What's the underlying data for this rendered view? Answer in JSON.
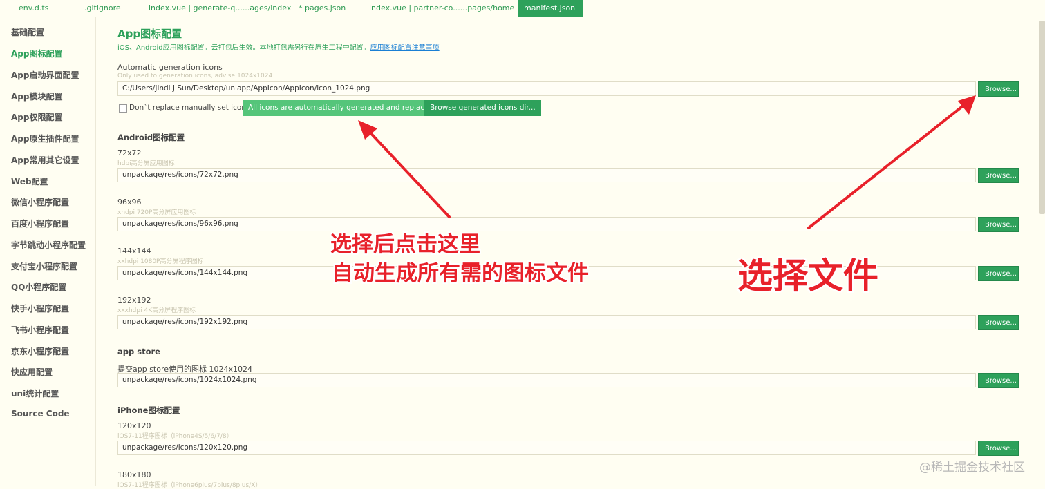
{
  "tabs": [
    {
      "label": "env.d.ts"
    },
    {
      "label": ".gitignore"
    },
    {
      "label": "index.vue | generate-q......ages/index"
    },
    {
      "label": "* pages.json"
    },
    {
      "label": "index.vue | partner-co......pages/home"
    },
    {
      "label": "manifest.json"
    }
  ],
  "sidebar": {
    "items": [
      {
        "label": "基础配置"
      },
      {
        "label": "App图标配置"
      },
      {
        "label": "App启动界面配置"
      },
      {
        "label": "App模块配置"
      },
      {
        "label": "App权限配置"
      },
      {
        "label": "App原生插件配置"
      },
      {
        "label": "App常用其它设置"
      },
      {
        "label": "Web配置"
      },
      {
        "label": "微信小程序配置"
      },
      {
        "label": "百度小程序配置"
      },
      {
        "label": "字节跳动小程序配置"
      },
      {
        "label": "支付宝小程序配置"
      },
      {
        "label": "QQ小程序配置"
      },
      {
        "label": "快手小程序配置"
      },
      {
        "label": "飞书小程序配置"
      },
      {
        "label": "京东小程序配置"
      },
      {
        "label": "快应用配置"
      },
      {
        "label": "uni统计配置"
      },
      {
        "label": "Source Code"
      }
    ]
  },
  "main": {
    "title": "App图标配置",
    "description": "iOS、Android应用图标配置。云打包后生效。本地打包需另行在原生工程中配置。",
    "description_link": "应用图标配置注意事项",
    "auto": {
      "label": "Automatic generation icons",
      "hint": "Only used to generation icons, advise:1024x1024",
      "value": "C:/Users/Jindi J Sun/Desktop/uniapp/AppIcon/AppIcon/icon_1024.png",
      "browse_label": "Browse...",
      "checkbox_label": "Don`t replace manually set icons",
      "generate_label": "All icons are automatically generated and replaced",
      "browse_dir_label": "Browse generated icons dir..."
    },
    "android_title": "Android图标配置",
    "android": [
      {
        "label": "72x72",
        "hint": "hdpi高分屏应用图标",
        "value": "unpackage/res/icons/72x72.png",
        "browse": "Browse..."
      },
      {
        "label": "96x96",
        "hint": "xhdpi 720P高分屏应用图标",
        "value": "unpackage/res/icons/96x96.png",
        "browse": "Browse..."
      },
      {
        "label": "144x144",
        "hint": "xxhdpi 1080P高分屏程序图标",
        "value": "unpackage/res/icons/144x144.png",
        "browse": "Browse..."
      },
      {
        "label": "192x192",
        "hint": "xxxhdpi 4K高分屏程序图标",
        "value": "unpackage/res/icons/192x192.png",
        "browse": "Browse..."
      }
    ],
    "appstore_title": "app store",
    "appstore": {
      "label": "提交app store使用的图标 1024x1024",
      "value": "unpackage/res/icons/1024x1024.png",
      "browse": "Browse..."
    },
    "iphone_title": "iPhone图标配置",
    "iphone": [
      {
        "label": "120x120",
        "hint": "iOS7-11程序图标（iPhone4S/5/6/7/8）",
        "value": "unpackage/res/icons/120x120.png",
        "browse": "Browse..."
      },
      {
        "label": "180x180",
        "hint": "iOS7-11程序图标（iPhone6plus/7plus/8plus/X）"
      }
    ]
  },
  "annotations": {
    "left_line1": "选择后点击这里",
    "left_line2": "自动生成所有需的图标文件",
    "right": "选择文件",
    "color": "#e8212a"
  },
  "watermark": "@稀土掘金技术社区"
}
